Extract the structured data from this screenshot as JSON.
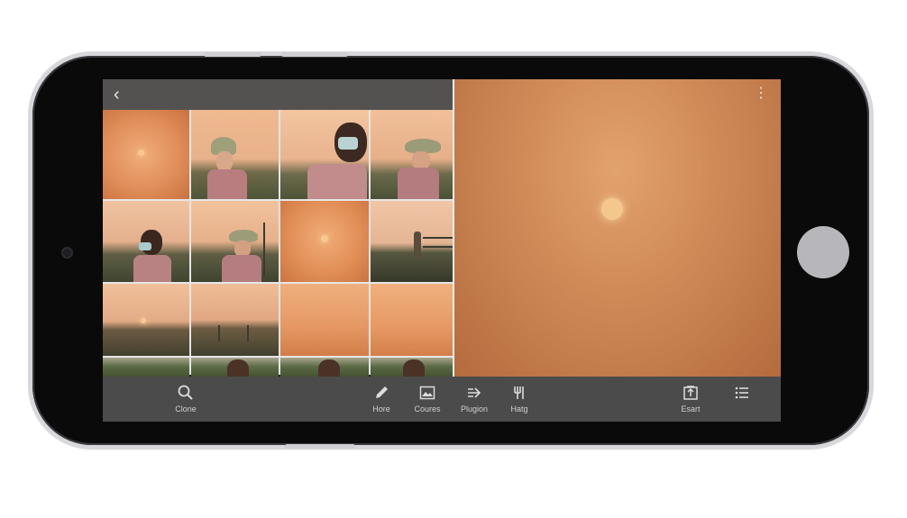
{
  "device": {
    "type": "phone-landscape"
  },
  "gallery": {
    "back_label": "‹",
    "more_label": "⋮",
    "thumbnails": [
      {
        "kind": "sunset-sun"
      },
      {
        "kind": "person-hat-mask"
      },
      {
        "kind": "person-mask-closeup"
      },
      {
        "kind": "person-hat"
      },
      {
        "kind": "person-mask-field"
      },
      {
        "kind": "person-hat-fence"
      },
      {
        "kind": "sunset-sun"
      },
      {
        "kind": "field-figure"
      },
      {
        "kind": "field-horizon"
      },
      {
        "kind": "field-road"
      },
      {
        "kind": "sunset-haze"
      },
      {
        "kind": "sunset-haze"
      },
      {
        "kind": "field-trees"
      },
      {
        "kind": "person-face"
      },
      {
        "kind": "person-face"
      },
      {
        "kind": "person-face"
      }
    ]
  },
  "toolbar": {
    "items": [
      {
        "name": "clone",
        "label": "Clone",
        "icon": "search-icon"
      },
      {
        "name": "hore",
        "label": "Hore",
        "icon": "pencil-icon"
      },
      {
        "name": "courses",
        "label": "Coures",
        "icon": "image-icon"
      },
      {
        "name": "plugion",
        "label": "Plugion",
        "icon": "arrow-icon"
      },
      {
        "name": "hatg",
        "label": "Hatg",
        "icon": "fork-icon"
      },
      {
        "name": "esart",
        "label": "Esart",
        "icon": "export-icon"
      },
      {
        "name": "menu",
        "label": "",
        "icon": "list-icon"
      }
    ]
  },
  "colors": {
    "accent": "#d18b59",
    "toolbar": "#4b4b4b",
    "topbar": "#545251"
  }
}
